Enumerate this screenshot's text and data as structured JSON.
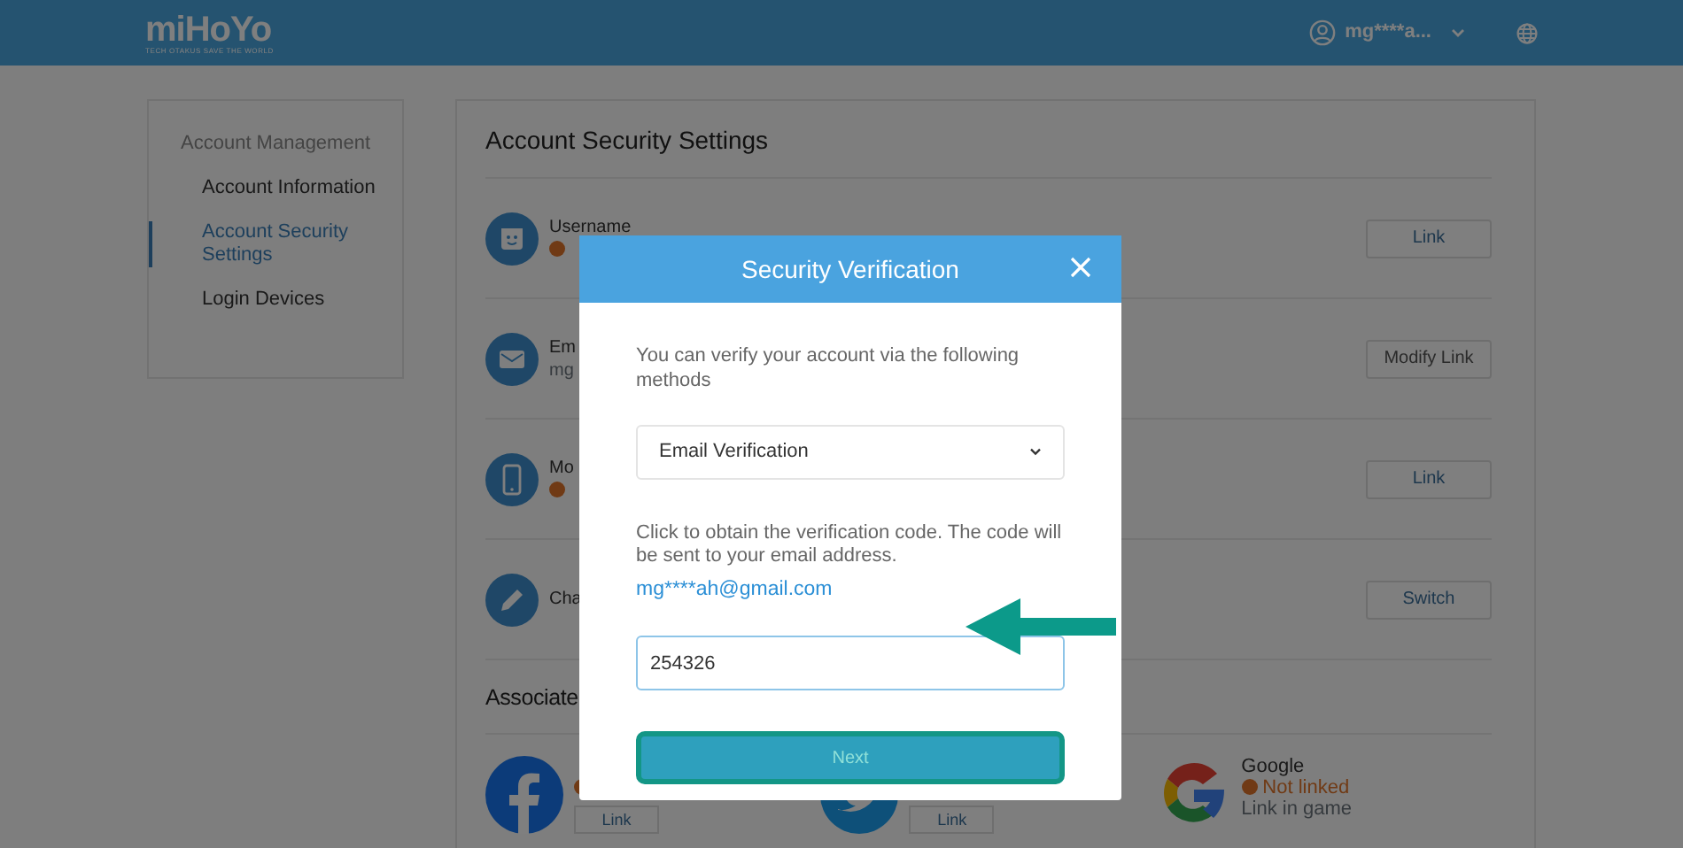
{
  "header": {
    "logo": "miHoYo",
    "tagline": "TECH OTAKUS SAVE THE WORLD",
    "user": "mg****a..."
  },
  "sidebar": {
    "heading": "Account Management",
    "items": [
      {
        "label": "Account Information",
        "selected": false
      },
      {
        "label": "Account Security Settings",
        "selected": true
      },
      {
        "label": "Login Devices",
        "selected": false
      }
    ]
  },
  "security": {
    "title": "Account Security Settings",
    "rows": [
      {
        "kind": "username",
        "title": "Username",
        "warning": true,
        "button": "Link"
      },
      {
        "kind": "email",
        "title": "Em",
        "detail": "mg",
        "button": "Modify Link"
      },
      {
        "kind": "mobile",
        "title": "Mo",
        "warning": true,
        "button": "Link"
      },
      {
        "kind": "password",
        "title": "Cha",
        "button": "Switch"
      }
    ]
  },
  "associated": {
    "title": "Associate",
    "accounts": [
      {
        "kind": "facebook",
        "warning": true,
        "button": "Link"
      },
      {
        "kind": "twitter",
        "button": "Link"
      },
      {
        "kind": "google",
        "name": "Google",
        "status": "Not linked",
        "warning": true,
        "note": "Link in game"
      }
    ]
  },
  "modal": {
    "title": "Security Verification",
    "intro": "You can verify your account via the following methods",
    "method": "Email Verification",
    "instructions": "Click to obtain the verification code. The code will be sent to your email address.",
    "email": "mg****ah@gmail.com",
    "code": "254326",
    "next": "Next"
  }
}
